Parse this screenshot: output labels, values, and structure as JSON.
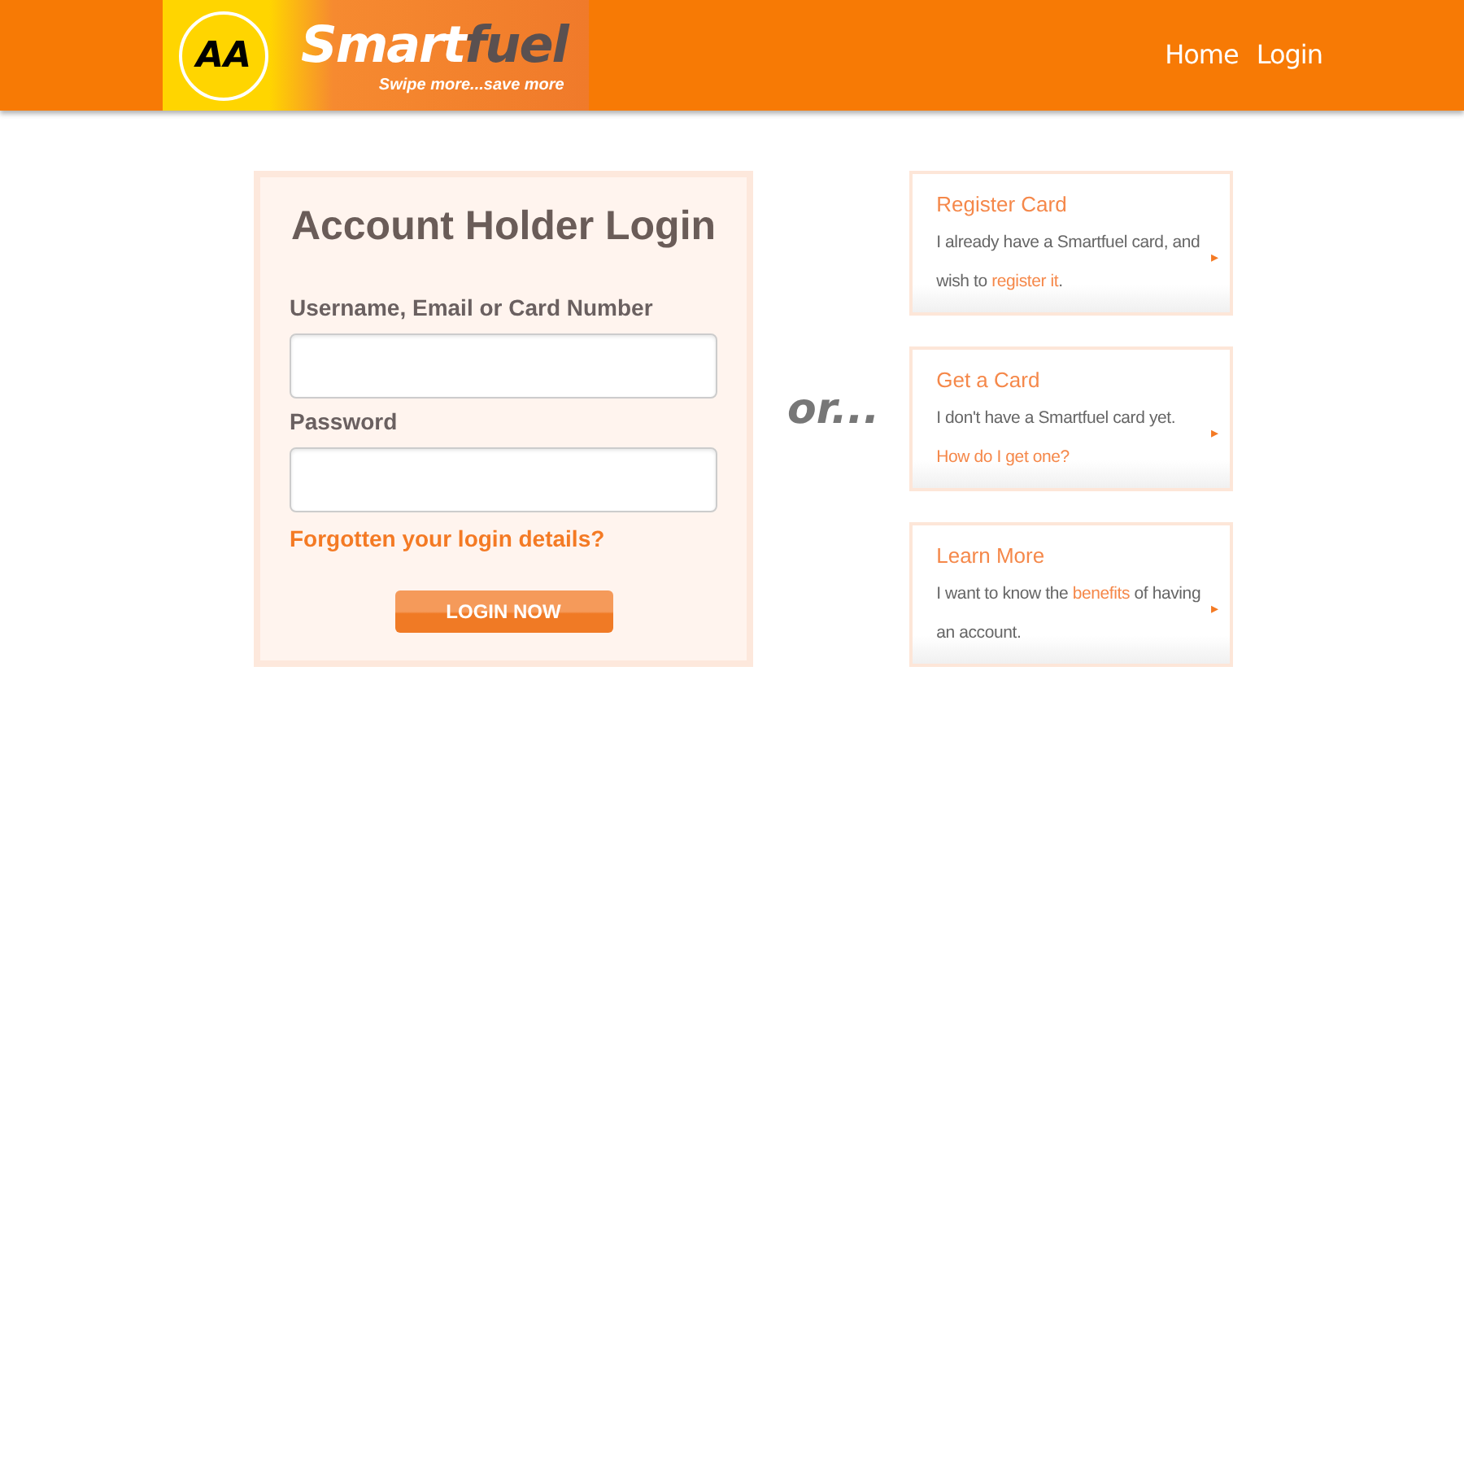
{
  "header": {
    "logo": {
      "badge": "AA",
      "brand_start": "Smart",
      "brand_end": "fuel",
      "tagline": "Swipe more...save more"
    },
    "nav": [
      "Home",
      "Login"
    ]
  },
  "login": {
    "title": "Account Holder Login",
    "fields": [
      {
        "label": "Username, Email or Card Number"
      },
      {
        "label": "Password"
      }
    ],
    "forgot_link": "Forgotten your login details?",
    "submit": "LOGIN NOW"
  },
  "separator": "or...",
  "cards": [
    {
      "title": "Register Card",
      "arrow": "▸",
      "text_before": "I already have a Smartfuel card, and wish to ",
      "link": "register it",
      "text_after": "."
    },
    {
      "title": "Get a Card",
      "arrow": "▸",
      "text_before": "I don't have a Smartfuel card yet. ",
      "link": "How do I get one?"
    },
    {
      "title": "Learn More",
      "arrow": "▸",
      "text_before": "I want to know the ",
      "link": "benefits",
      "text_after": " of having an account."
    }
  ]
}
